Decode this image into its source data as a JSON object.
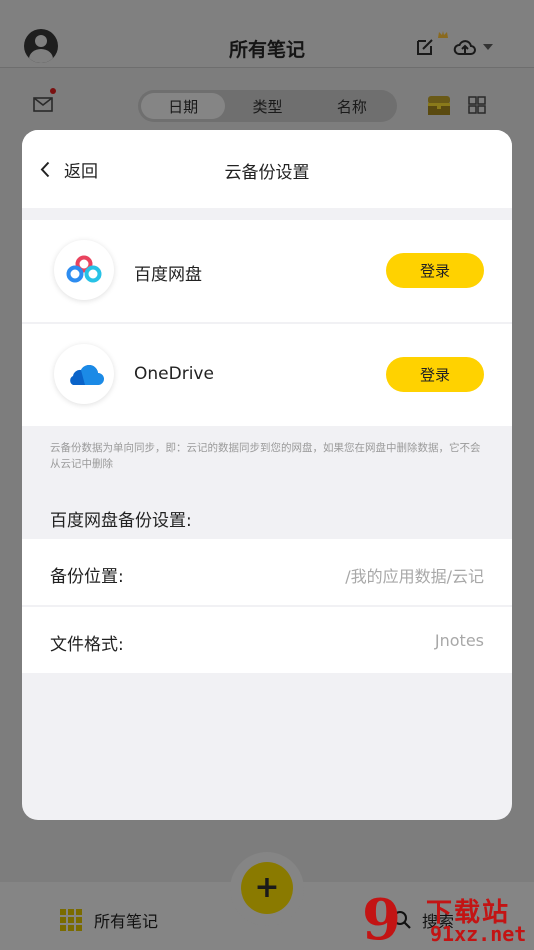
{
  "app": {
    "title": "所有笔记",
    "tabs": [
      "日期",
      "类型",
      "名称"
    ],
    "active_tab": 0,
    "bottom_nav": {
      "notes_label": "所有笔记",
      "search_label": "搜索",
      "add_label": "+"
    }
  },
  "modal": {
    "back_label": "返回",
    "title": "云备份设置",
    "providers": [
      {
        "name": "百度网盘",
        "login_label": "登录"
      },
      {
        "name": "OneDrive",
        "login_label": "登录"
      }
    ],
    "hint": "云备份数据为单向同步，即：云记的数据同步到您的网盘，如果您在网盘中删除数据，它不会从云记中删除",
    "baidu_settings": {
      "section_title": "百度网盘备份设置:",
      "location_label": "备份位置:",
      "location_value": "/我的应用数据/云记",
      "format_label": "文件格式:",
      "format_value": "Jnotes"
    }
  },
  "watermark": {
    "mark": "9",
    "text": "下载站",
    "domain": "91xz.net"
  },
  "colors": {
    "accent": "#ffd200",
    "overlay": "#808080",
    "watermark": "#c31414"
  }
}
